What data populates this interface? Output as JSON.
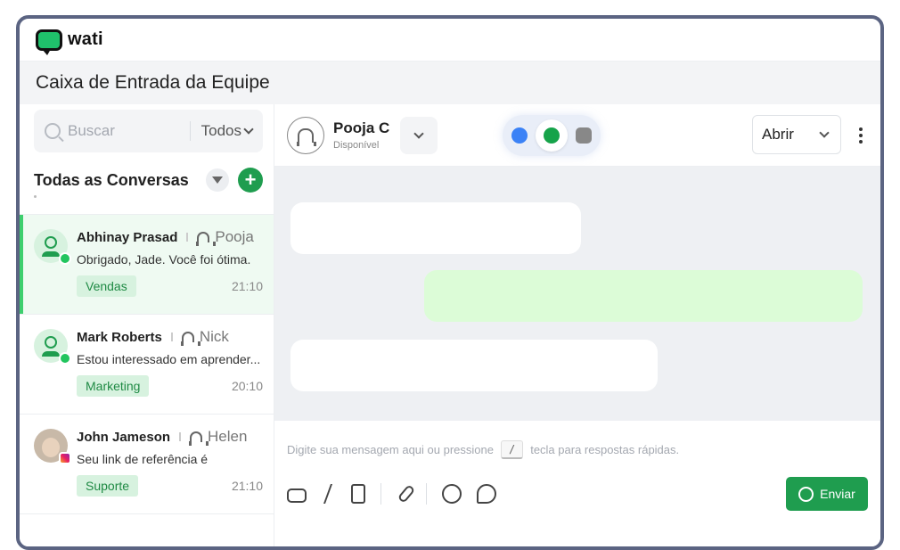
{
  "app": {
    "logo_text": "wati",
    "page_title": "Caixa de Entrada da Equipe"
  },
  "colors": {
    "brand_green": "#1f9d4f",
    "active_bg": "#effaf2",
    "tag_bg": "#d7f2df"
  },
  "sidebar": {
    "search_placeholder": "Buscar",
    "filter_value": "Todos",
    "list_title": "Todas as Conversas",
    "conversations": [
      {
        "name": "Abhinay Prasad",
        "agent": "Pooja",
        "message": "Obrigado, Jade. Você foi ótima.",
        "tag": "Vendas",
        "time": "21:10",
        "channel": "whatsapp",
        "active": true
      },
      {
        "name": "Mark Roberts",
        "agent": "Nick",
        "message": "Estou interessado em aprender...",
        "tag": "Marketing",
        "time": "20:10",
        "channel": "whatsapp",
        "active": false
      },
      {
        "name": "John Jameson",
        "agent": "Helen",
        "message": "Seu link de referência é",
        "tag": "Suporte",
        "time": "21:10",
        "channel": "instagram",
        "active": false
      }
    ]
  },
  "chat": {
    "agent_name": "Pooja C",
    "agent_status": "Disponível",
    "status_value": "Abrir",
    "channels": [
      "link-icon",
      "whatsapp-icon",
      "instagram-icon"
    ],
    "composer_before": "Digite sua mensagem aqui ou pressione",
    "composer_key": "/",
    "composer_after": "tecla para respostas rápidas.",
    "send_label": "Enviar"
  }
}
